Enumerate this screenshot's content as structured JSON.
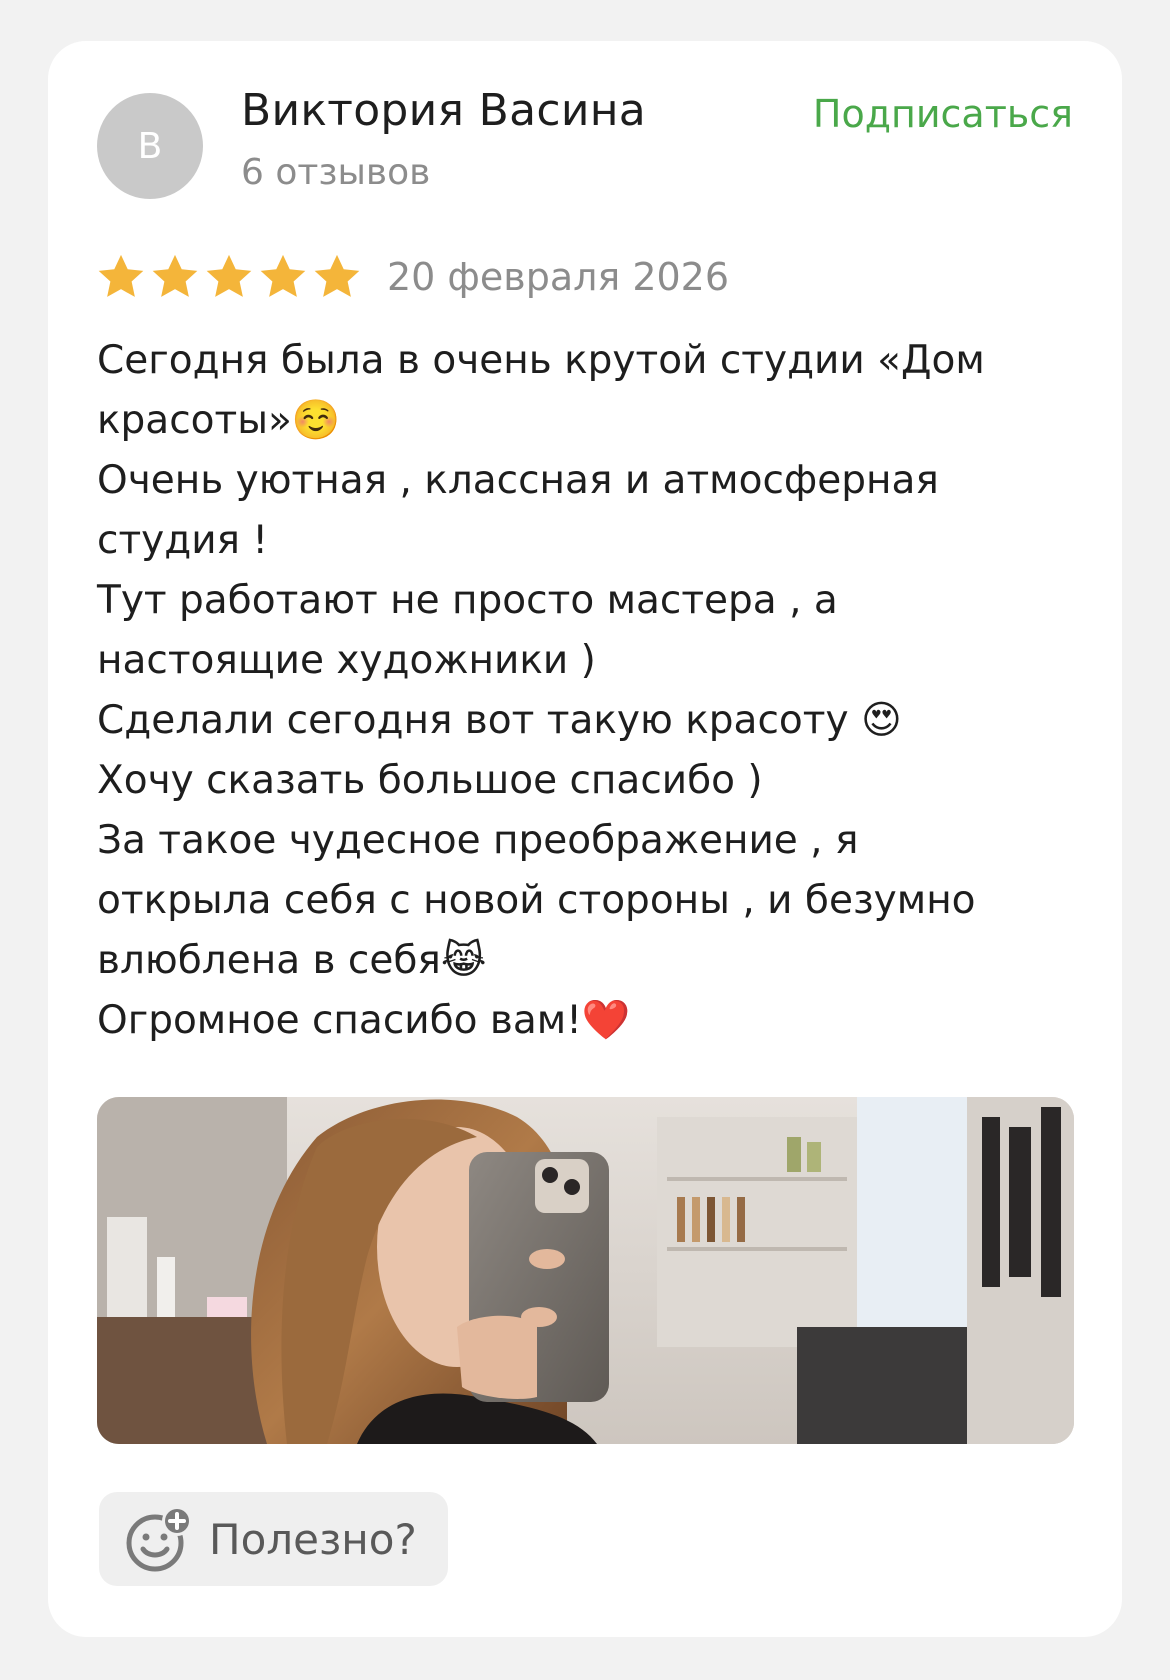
{
  "author": {
    "avatar_letter": "В",
    "name": "Виктория Васина",
    "reviews_count": "6 отзывов",
    "subscribe_label": "Подписаться"
  },
  "rating": {
    "stars": 5,
    "max": 5,
    "date": "20 февраля 2026"
  },
  "review": {
    "lines": [
      "Сегодня была в очень крутой студии «Дом",
      "красоты»☺️",
      "Очень уютная , классная и атмосферная",
      "студия !",
      "Тут работают не просто мастера , а",
      "настоящие художники )",
      "Сделали сегодня вот такую красоту 😍",
      "Хочу сказать большое спасибо )",
      "За такое чудесное преображение , я",
      "открыла себя с новой стороны , и безумно",
      "влюблена в себя😹",
      "Огромное спасибо вам!❤️"
    ]
  },
  "helpful": {
    "label": "Полезно?"
  },
  "colors": {
    "accent_green": "#4aa84a",
    "star_gold": "#f4b53a",
    "muted_text": "#8c8c8c"
  },
  "icons": {
    "star": "star-icon",
    "helpful": "smile-plus-icon"
  }
}
